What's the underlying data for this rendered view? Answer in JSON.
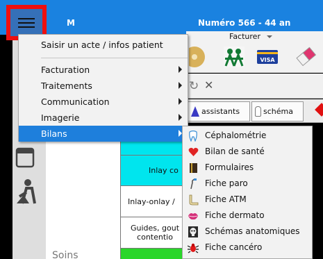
{
  "titlebar": {
    "lead": "M",
    "text": "Numéro 566  -  44 an"
  },
  "toolbar": {
    "facturer_label": "Facturer",
    "visa_text": "VISA"
  },
  "tabs": [
    {
      "label": "assistants",
      "icon": "wizard-hat-icon"
    },
    {
      "label": "schéma",
      "icon": "tooth-icon"
    }
  ],
  "table": {
    "cells": [
      {
        "text": "",
        "color": "#00e5ee"
      },
      {
        "text": "Inlay co",
        "color": "#00e5ee"
      },
      {
        "text": "Inlay-onlay /",
        "color": "#ffffff"
      },
      {
        "text": "Guides, gout contentio",
        "color": "#ffffff"
      },
      {
        "text": "",
        "color": "#2ad62a"
      }
    ]
  },
  "content": {
    "soins_label": "Soins"
  },
  "main_menu": {
    "top_item": "Saisir un acte / infos patient",
    "items": [
      {
        "label": "Facturation",
        "has_submenu": true
      },
      {
        "label": "Traitements",
        "has_submenu": true
      },
      {
        "label": "Communication",
        "has_submenu": true
      },
      {
        "label": "Imagerie",
        "has_submenu": true
      },
      {
        "label": "Bilans",
        "has_submenu": true,
        "active": true
      }
    ]
  },
  "sub_menu": {
    "items": [
      {
        "label": "Céphalométrie",
        "icon": "tooth-outline-icon"
      },
      {
        "label": "Bilan de santé",
        "icon": "heart-icon"
      },
      {
        "label": "Formulaires",
        "icon": "book-icon"
      },
      {
        "label": "Fiche paro",
        "icon": "dental-probe-icon"
      },
      {
        "label": "Fiche ATM",
        "icon": "jaw-icon"
      },
      {
        "label": "Fiche dermato",
        "icon": "lips-icon"
      },
      {
        "label": "Schémas anatomiques",
        "icon": "skull-icon"
      },
      {
        "label": "Fiche cancéro",
        "icon": "cancer-bug-icon"
      }
    ]
  },
  "colors": {
    "accent": "#1e7fdc",
    "highlight_border": "#ee0f0f",
    "titlebar": "#1a82e0"
  }
}
